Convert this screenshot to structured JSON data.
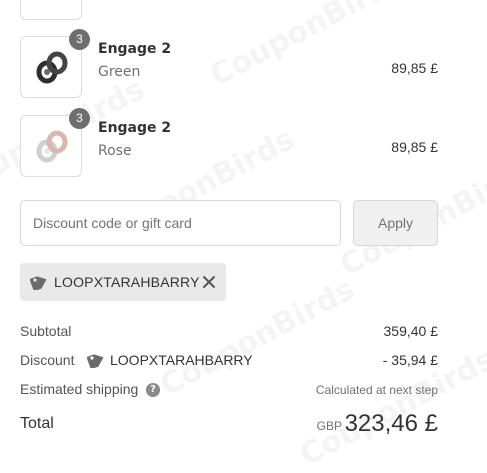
{
  "watermark": "CouponBirds",
  "products": [
    {
      "name": "Engage 2",
      "variant": "Green",
      "quantity": "3",
      "price": "89,85 £",
      "thumb_color": "#2e2e2e"
    },
    {
      "name": "Engage 2",
      "variant": "Rose",
      "quantity": "3",
      "price": "89,85 £",
      "thumb_color": "#d9b7b0"
    }
  ],
  "discount": {
    "placeholder": "Discount code or gift card",
    "apply_label": "Apply",
    "applied_code": "LOOPXTARAHBARRY"
  },
  "summary": {
    "subtotal_label": "Subtotal",
    "subtotal_value": "359,40 £",
    "discount_label": "Discount",
    "discount_code": "LOOPXTARAHBARRY",
    "discount_value": "- 35,94 £",
    "shipping_label": "Estimated shipping",
    "shipping_value": "Calculated at next step",
    "total_label": "Total",
    "currency": "GBP",
    "total_value": "323,46 £"
  }
}
